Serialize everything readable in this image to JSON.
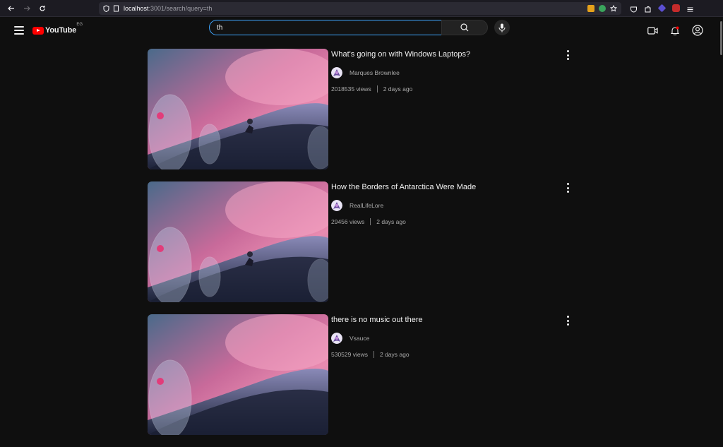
{
  "browser": {
    "url_host": "localhost",
    "url_path": ":3001/search/query=th"
  },
  "header": {
    "logo_text": "YouTube",
    "region": "EG",
    "search_value": "th"
  },
  "results": [
    {
      "title": "What's going on with Windows Laptops?",
      "channel": "Marques Brownlee",
      "views": "2018535 views",
      "age": "2 days ago"
    },
    {
      "title": "How the Borders of Antarctica Were Made",
      "channel": "RealLifeLore",
      "views": "29456 views",
      "age": "2 days ago"
    },
    {
      "title": "there is no music out there",
      "channel": "Vsauce",
      "views": "530529 views",
      "age": "2 days ago"
    }
  ],
  "colors": {
    "accent": "#3ea6ff",
    "brand": "#ff0000",
    "background": "#0f0f0f"
  }
}
